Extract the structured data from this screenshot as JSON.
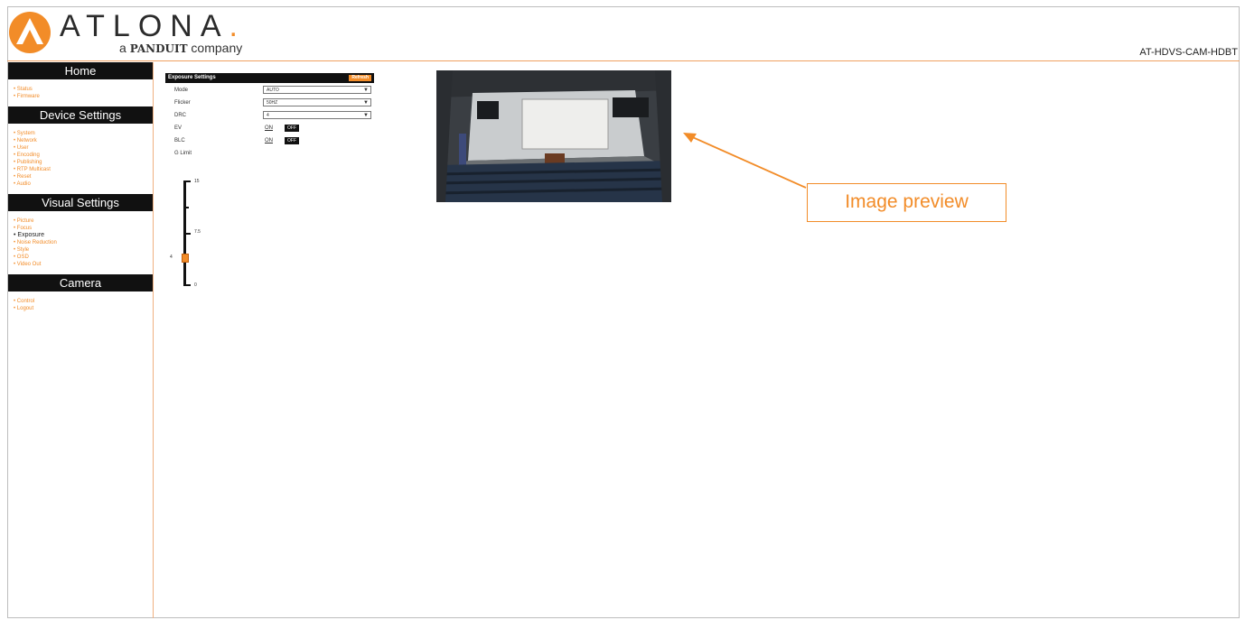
{
  "brand": {
    "name": "ATLONA",
    "dot": ".",
    "tagline_prefix": "a ",
    "tagline_brand": "PANDUIT",
    "tagline_suffix": " company"
  },
  "device_model": "AT-HDVS-CAM-HDBT",
  "sidebar": {
    "sections": [
      {
        "title": "Home",
        "items": [
          "Status",
          "Firmware"
        ]
      },
      {
        "title": "Device Settings",
        "items": [
          "System",
          "Network",
          "User",
          "Encoding",
          "Publishing",
          "RTP Multicast",
          "Reset",
          "Audio"
        ]
      },
      {
        "title": "Visual Settings",
        "items": [
          "Picture",
          "Focus",
          "Exposure",
          "Noise Reduction",
          "Style",
          "OSD",
          "Video Out"
        ],
        "active": "Exposure"
      },
      {
        "title": "Camera",
        "items": [
          "Control",
          "Logout"
        ]
      }
    ]
  },
  "exposure": {
    "title": "Exposure Settings",
    "refresh_label": "Refresh",
    "mode": {
      "label": "Mode",
      "value": "AUTO"
    },
    "flicker": {
      "label": "Flicker",
      "value": "50HZ"
    },
    "drc": {
      "label": "DRC",
      "value": "4"
    },
    "ev": {
      "label": "EV",
      "on_label": "ON",
      "off_label": "OFF"
    },
    "blc": {
      "label": "BLC",
      "on_label": "ON",
      "off_label": "OFF"
    },
    "glimit": {
      "label": "G Limit",
      "max": "15",
      "mid": "7.5",
      "min": "0",
      "current": "4",
      "current_value": 4,
      "range": [
        0,
        15
      ]
    }
  },
  "annotation": {
    "label": "Image preview"
  },
  "colors": {
    "accent": "#f28c28",
    "dark": "#111111"
  }
}
